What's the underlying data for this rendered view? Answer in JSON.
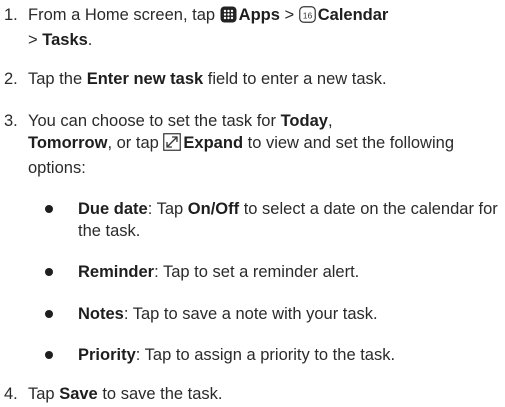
{
  "steps": [
    {
      "number": "1.",
      "part1": "From a Home screen, tap",
      "apps": "Apps",
      "sep1": ">",
      "calendar": "Calendar",
      "sep2": ">",
      "tasks": "Tasks",
      "end": "."
    },
    {
      "number": "2.",
      "pre": "Tap the",
      "bold": "Enter new task",
      "post": "field to enter a new task."
    },
    {
      "number": "3.",
      "pre": "You can choose to set the task for",
      "today": "Today",
      "comma": ",",
      "tomorrow": "Tomorrow",
      "mid": ", or tap",
      "expand": "Expand",
      "post": "to view and set the following options:"
    },
    {
      "number": "4.",
      "pre": "Tap",
      "bold": "Save",
      "post": "to save the task."
    }
  ],
  "options": [
    {
      "term": "Due date",
      "colon": ":",
      "pre": "Tap",
      "bold": "On/Off",
      "post": "to select a date on the calendar for the task."
    },
    {
      "term": "Reminder",
      "colon": ":",
      "text": "Tap to set a reminder alert."
    },
    {
      "term": "Notes",
      "colon": ":",
      "text": "Tap to save a note with your task."
    },
    {
      "term": "Priority",
      "colon": ":",
      "text": "Tap to assign a priority to the task."
    }
  ],
  "icons": {
    "apps": "apps-grid-icon",
    "calendar": "calendar-icon",
    "calendar_day": "16",
    "expand": "expand-icon"
  }
}
